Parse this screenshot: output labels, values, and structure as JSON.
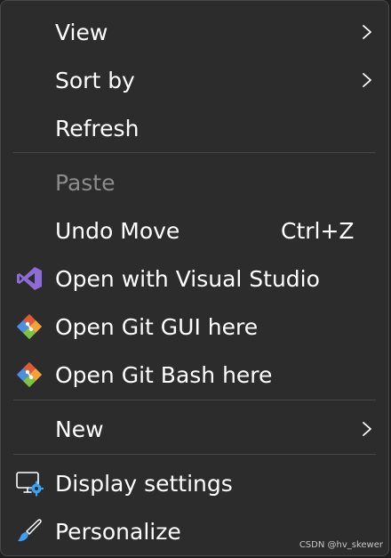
{
  "menu": {
    "items": [
      {
        "label": "View"
      },
      {
        "label": "Sort by"
      },
      {
        "label": "Refresh"
      },
      {
        "label": "Paste"
      },
      {
        "label": "Undo Move",
        "shortcut": "Ctrl+Z"
      },
      {
        "label": "Open with Visual Studio",
        "icon": "visual-studio-icon"
      },
      {
        "label": "Open Git GUI here",
        "icon": "git-gui-icon"
      },
      {
        "label": "Open Git Bash here",
        "icon": "git-bash-icon"
      },
      {
        "label": "New"
      },
      {
        "label": "Display settings",
        "icon": "display-settings-icon"
      },
      {
        "label": "Personalize",
        "icon": "personalize-brush-icon"
      }
    ]
  },
  "watermark": "CSDN @hv_skewer",
  "colors": {
    "background": "#2c2c2c",
    "text": "#ffffff",
    "disabled_text": "#8c8c8c",
    "separator": "#474747",
    "visual_studio_purple": "#8e6cd8",
    "accent_blue": "#3aa0f0"
  }
}
